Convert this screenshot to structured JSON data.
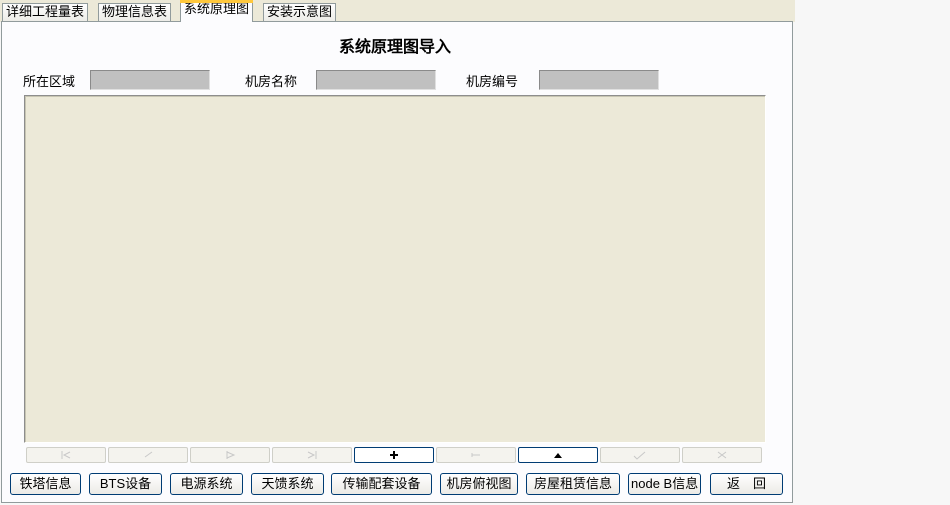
{
  "tabs": [
    {
      "label": "详细工程量表",
      "active": false
    },
    {
      "label": "物理信息表",
      "active": false
    },
    {
      "label": "系统原理图",
      "active": true
    },
    {
      "label": "安装示意图",
      "active": false
    }
  ],
  "page_title": "系统原理图导入",
  "fields": {
    "region": {
      "label": "所在区域",
      "value": ""
    },
    "room_name": {
      "label": "机房名称",
      "value": ""
    },
    "room_number": {
      "label": "机房编号",
      "value": ""
    }
  },
  "navigator": [
    {
      "name": "first-icon",
      "enabled": false
    },
    {
      "name": "prior-icon",
      "enabled": false
    },
    {
      "name": "next-icon",
      "enabled": false
    },
    {
      "name": "last-icon",
      "enabled": false
    },
    {
      "name": "insert-icon",
      "enabled": true
    },
    {
      "name": "delete-icon",
      "enabled": false
    },
    {
      "name": "edit-icon",
      "enabled": true
    },
    {
      "name": "post-icon",
      "enabled": false
    },
    {
      "name": "cancel-icon",
      "enabled": false
    }
  ],
  "buttons": {
    "tower": "铁塔信息",
    "bts": "BTS设备",
    "power": "电源系统",
    "antenna": "天馈系统",
    "transmission": "传输配套设备",
    "room_view": "机房俯视图",
    "rental": "房屋租赁信息",
    "nodeb": "node B信息",
    "back": "返　回"
  }
}
